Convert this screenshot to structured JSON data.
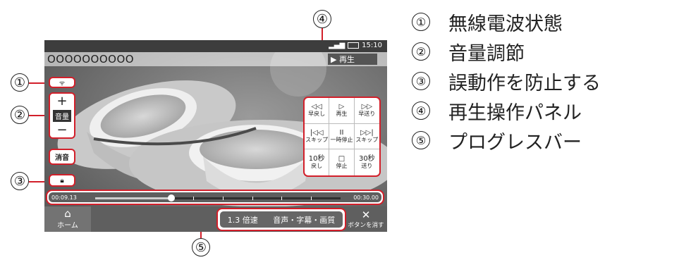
{
  "screen": {
    "status_time": "15:10",
    "title": "OOOOOOOOOO",
    "play_state": "▶ 再生",
    "volume": {
      "plus": "+",
      "label": "音量",
      "minus": "−"
    },
    "mute_label": "消音",
    "panel": [
      {
        "icon": "◁◁",
        "label": "早戻し"
      },
      {
        "icon": "▷",
        "label": "再生"
      },
      {
        "icon": "▷▷",
        "label": "早送り"
      },
      {
        "icon": "|◁◁",
        "label": "スキップ"
      },
      {
        "icon": "II",
        "label": "一時停止"
      },
      {
        "icon": "▷▷|",
        "label": "スキップ"
      },
      {
        "icon": "10秒",
        "label": "戻し"
      },
      {
        "icon": "□",
        "label": "停止"
      },
      {
        "icon": "30秒",
        "label": "送り"
      }
    ],
    "progress": {
      "current": "00:09.13",
      "total": "00:30.00",
      "position_fraction": 0.31
    },
    "home_label": "ホーム",
    "speed_label": "1.3 倍速",
    "audio_label": "音声・字幕・画質",
    "hide_label": "ボタンを消す"
  },
  "callouts": {
    "c1": "①",
    "c2": "②",
    "c3": "③",
    "c4": "④",
    "c5": "⑤"
  },
  "legend": [
    {
      "num": "①",
      "text": "無線電波状態"
    },
    {
      "num": "②",
      "text": "音量調節"
    },
    {
      "num": "③",
      "text": "誤動作を防止する"
    },
    {
      "num": "④",
      "text": "再生操作パネル"
    },
    {
      "num": "⑤",
      "text": "プログレスバー"
    }
  ],
  "colors": {
    "highlight": "#d21f2a"
  }
}
